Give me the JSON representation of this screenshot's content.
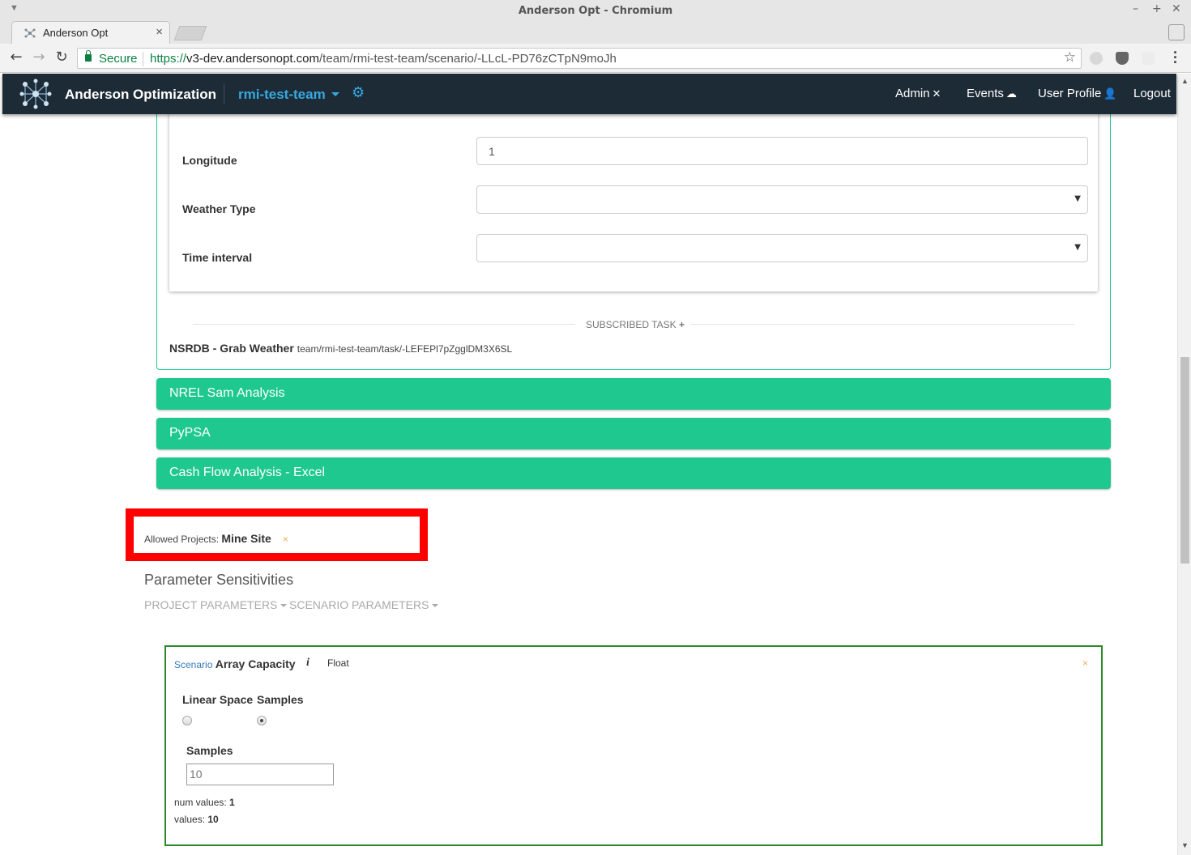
{
  "window": {
    "title": "Anderson Opt - Chromium"
  },
  "browser": {
    "tab_title": "Anderson Opt",
    "secure_label": "Secure",
    "url_scheme": "https://",
    "url_host": "v3-dev.andersonopt.com",
    "url_path": "/team/rmi-test-team/scenario/-LLcL-PD76zCTpN9moJh"
  },
  "appnav": {
    "brand": "Anderson Optimization",
    "team": "rmi-test-team",
    "links": {
      "admin": "Admin",
      "events": "Events",
      "profile": "User Profile",
      "logout": "Logout"
    }
  },
  "task_form": {
    "fields": [
      {
        "label": "Longitude",
        "value": "1"
      },
      {
        "label": "Weather Type",
        "value": ""
      },
      {
        "label": "Time interval",
        "value": ""
      }
    ],
    "subscribed_label": "SUBSCRIBED TASK",
    "subscribed_add": "+",
    "task_name": "NSRDB - Grab Weather",
    "task_path": "team/rmi-test-team/task/-LEFEPl7pZgglDM3X6SL"
  },
  "collapsed_tasks": [
    "NREL Sam Analysis",
    "PyPSA",
    "Cash Flow Analysis - Excel"
  ],
  "allowed_projects": {
    "label": "Allowed Projects:",
    "project": "Mine Site",
    "remove": "×"
  },
  "parameter_sensitivities": {
    "title": "Parameter Sensitivities",
    "menus": [
      "PROJECT PARAMETERS",
      "SCENARIO PARAMETERS"
    ]
  },
  "sensitivity_card": {
    "scope": "Scenario",
    "name": "Array Capacity",
    "info": "i",
    "type": "Float",
    "close": "×",
    "modes": [
      {
        "label": "Linear Space",
        "checked": false
      },
      {
        "label": "Samples",
        "checked": true
      }
    ],
    "samples_label": "Samples",
    "samples_value": "10",
    "num_values_label": "num values:",
    "num_values": "1",
    "values_label": "values:",
    "values": "10"
  },
  "colors": {
    "nav_bg": "#1d2b36",
    "accent_blue": "#36a9e1",
    "task_green": "#1fc88e",
    "highlight_red": "#ff0000",
    "card_border": "#2a8a2a"
  }
}
